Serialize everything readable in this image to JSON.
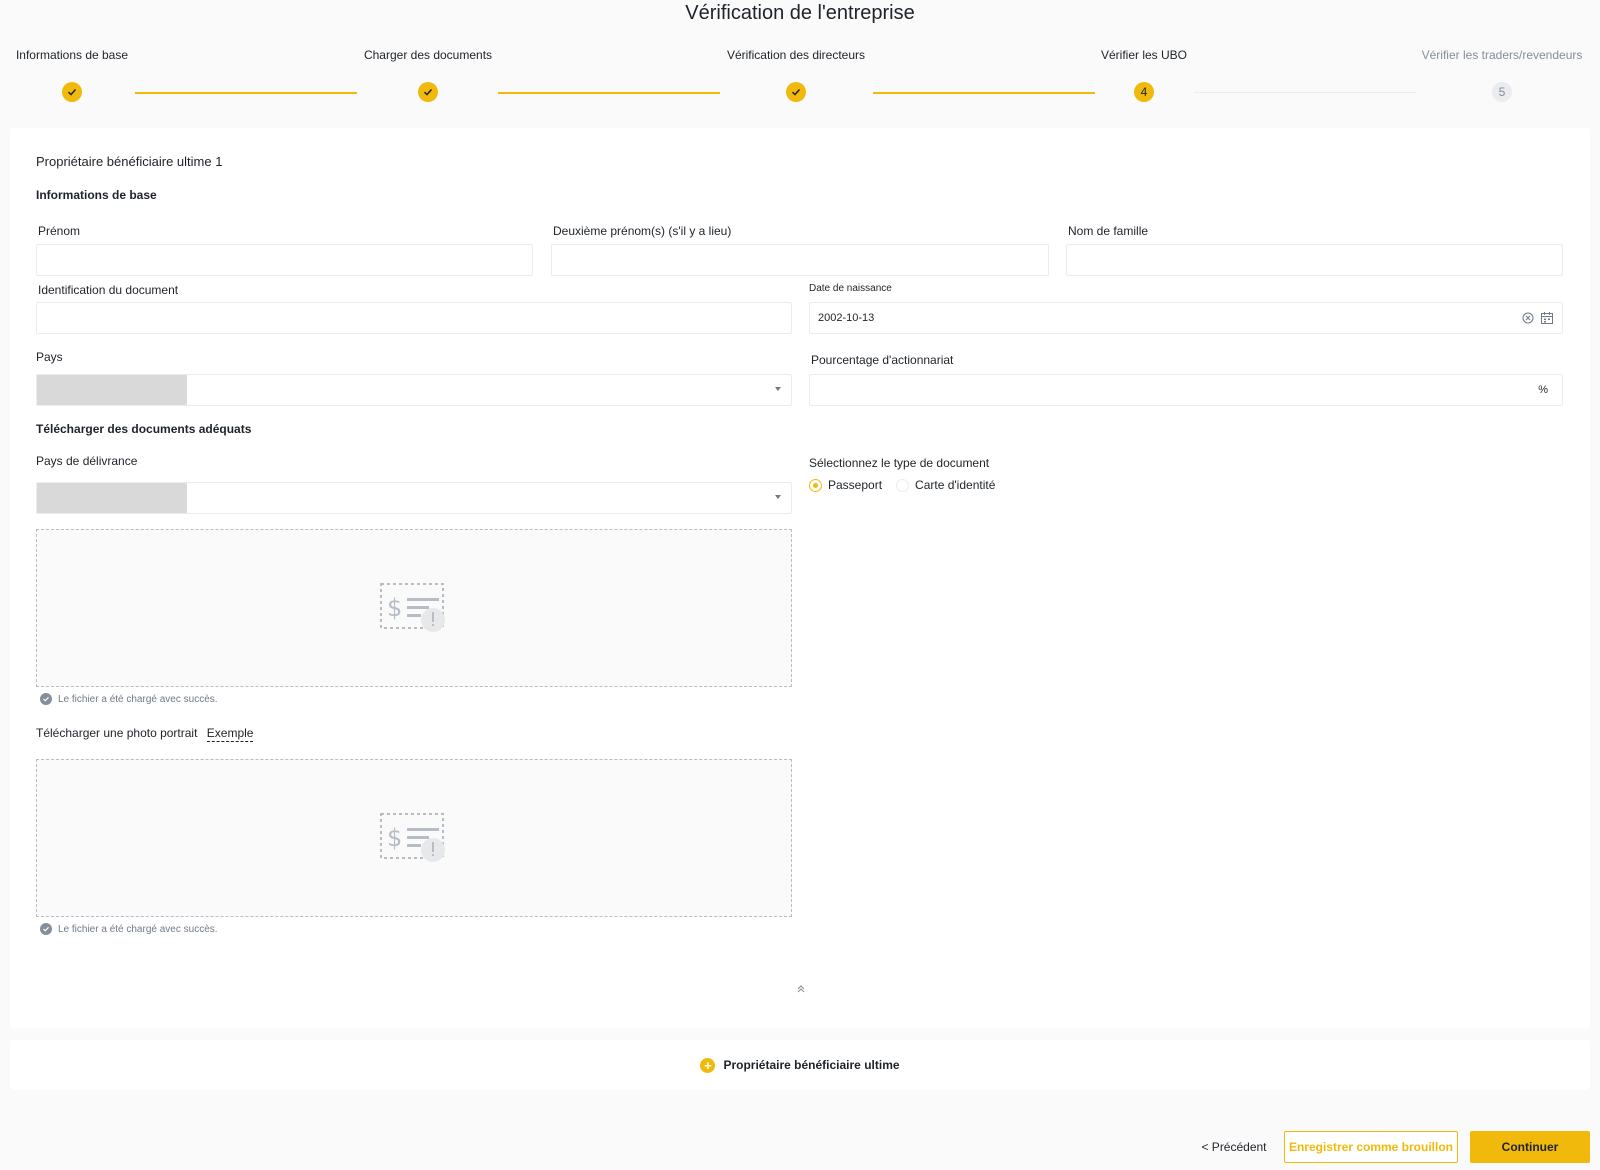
{
  "page": {
    "title": "Vérification de l'entreprise"
  },
  "steps": [
    {
      "label": "Informations de base",
      "status": "done",
      "number": "1"
    },
    {
      "label": "Charger des documents",
      "status": "done",
      "number": "2"
    },
    {
      "label": "Vérification des directeurs",
      "status": "done",
      "number": "3"
    },
    {
      "label": "Vérifier les UBO",
      "status": "current",
      "number": "4"
    },
    {
      "label": "Vérifier les traders/revendeurs",
      "status": "pending",
      "number": "5"
    }
  ],
  "form": {
    "title": "Propriétaire bénéficiaire ultime 1",
    "basic_info_title": "Informations de base",
    "first_name": {
      "label": "Prénom",
      "value": ""
    },
    "middle_name": {
      "label": "Deuxième prénom(s) (s'il y a lieu)",
      "value": ""
    },
    "last_name": {
      "label": "Nom de famille",
      "value": ""
    },
    "document_id": {
      "label": "Identification du document",
      "value": ""
    },
    "birth_date": {
      "label": "Date de naissance",
      "value": "2002-10-13"
    },
    "country": {
      "label": "Pays",
      "value": ""
    },
    "ownership": {
      "label": "Pourcentage d'actionnariat",
      "value": "",
      "suffix": "%"
    },
    "upload_section_title": "Télécharger des documents adéquats",
    "issuing_country": {
      "label": "Pays de délivrance",
      "value": ""
    },
    "doc_type": {
      "label": "Sélectionnez le type de document",
      "options": [
        "Passeport",
        "Carte d'identité"
      ],
      "selected": "Passeport"
    },
    "upload_success": "Le fichier a été chargé avec succès.",
    "portrait": {
      "label": "Télécharger une photo portrait",
      "example_link": "Exemple"
    },
    "upload_success_2": "Le fichier a été chargé avec succès."
  },
  "add_owner_label": "Propriétaire bénéficiaire ultime",
  "footer": {
    "prev_label": "< Précédent",
    "draft_label": "Enregistrer comme brouillon",
    "continue_label": "Continuer"
  },
  "colors": {
    "accent": "#f0b90b",
    "text": "#1e2329",
    "muted": "#848e9c",
    "border": "#eaecef"
  }
}
